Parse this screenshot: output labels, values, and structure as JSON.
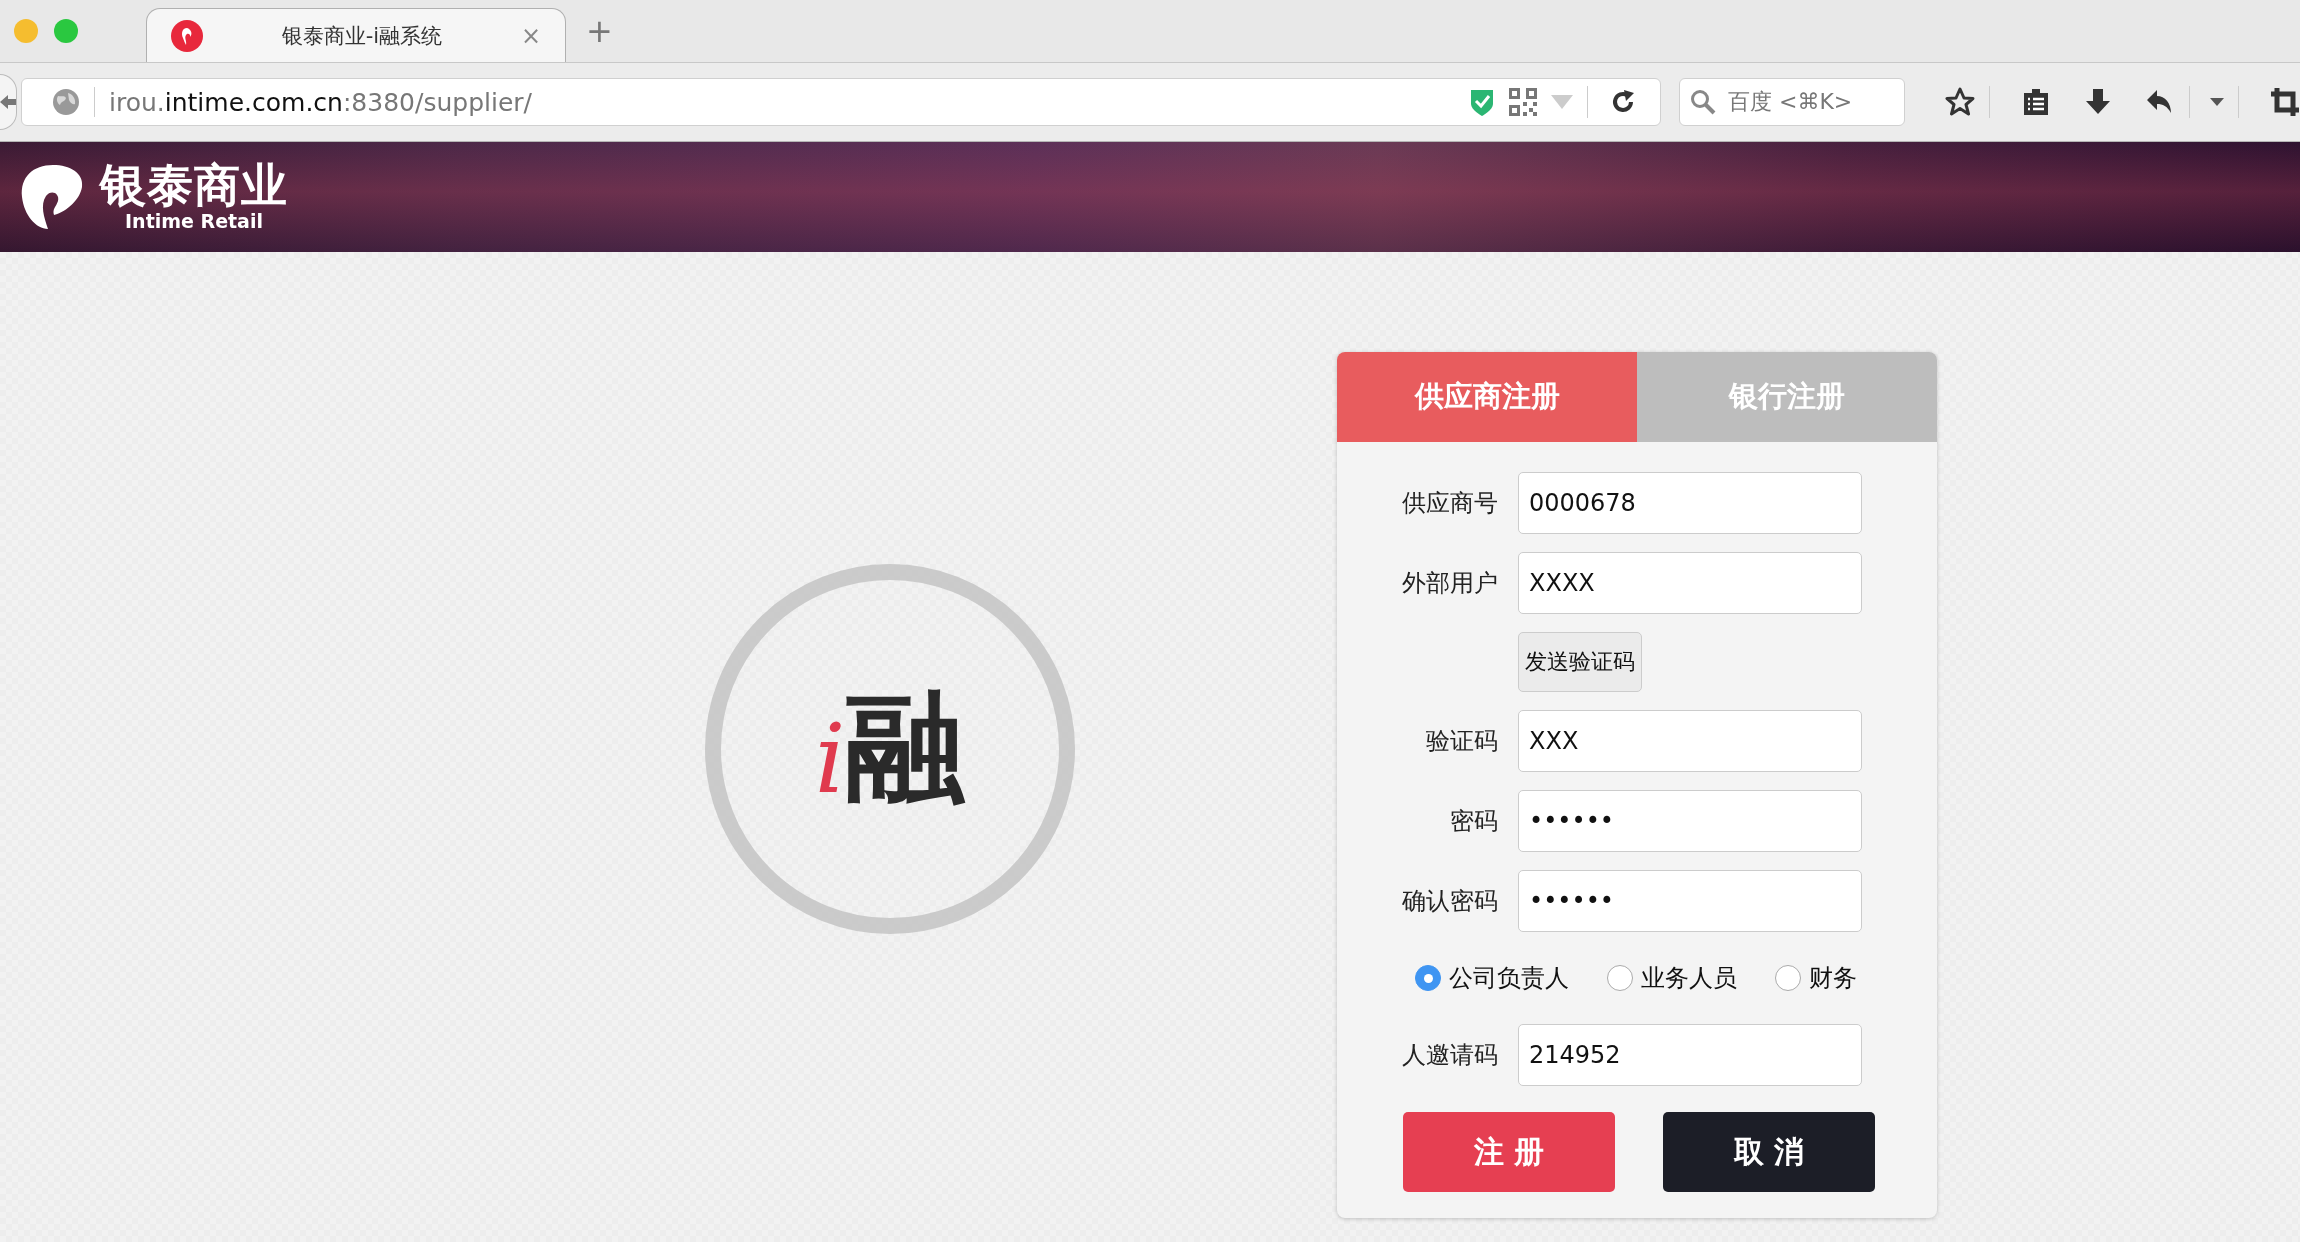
{
  "browser": {
    "tab": {
      "title": "银泰商业-i融系统",
      "close": "×",
      "selected": true
    },
    "new_tab": "+",
    "url": {
      "prefix": "irou.",
      "domain": "intime.com.cn",
      "suffix": ":8380/supplier/"
    },
    "search": {
      "placeholder": "百度 <⌘K>"
    }
  },
  "header": {
    "logo_text": "银泰商业",
    "logo_subtitle": "Intime Retail"
  },
  "brand_logo": {
    "mark": "i",
    "text": "融"
  },
  "form": {
    "tabs": [
      {
        "label": "供应商注册",
        "selected": true
      },
      {
        "label": "银行注册",
        "selected": false
      }
    ],
    "rows": [
      {
        "kind": "field",
        "label": "供应商号",
        "value": "0000678"
      },
      {
        "kind": "field",
        "label": "外部用户",
        "value": "XXXX"
      },
      {
        "kind": "button",
        "label": "发送验证码"
      },
      {
        "kind": "field",
        "label": "验证码",
        "value": "XXX"
      },
      {
        "kind": "field",
        "label": "密码",
        "value": "••••••"
      },
      {
        "kind": "field",
        "label": "确认密码",
        "value": "••••••"
      },
      {
        "kind": "radios",
        "options": [
          {
            "label": "公司负责人",
            "selected": true
          },
          {
            "label": "业务人员",
            "selected": false
          },
          {
            "label": "财务",
            "selected": false
          }
        ]
      },
      {
        "kind": "field",
        "label": "人邀请码",
        "value": "214952"
      }
    ],
    "buttons": [
      {
        "kind": "primary",
        "label": "注 册"
      },
      {
        "kind": "dark",
        "label": "取 消"
      }
    ]
  }
}
